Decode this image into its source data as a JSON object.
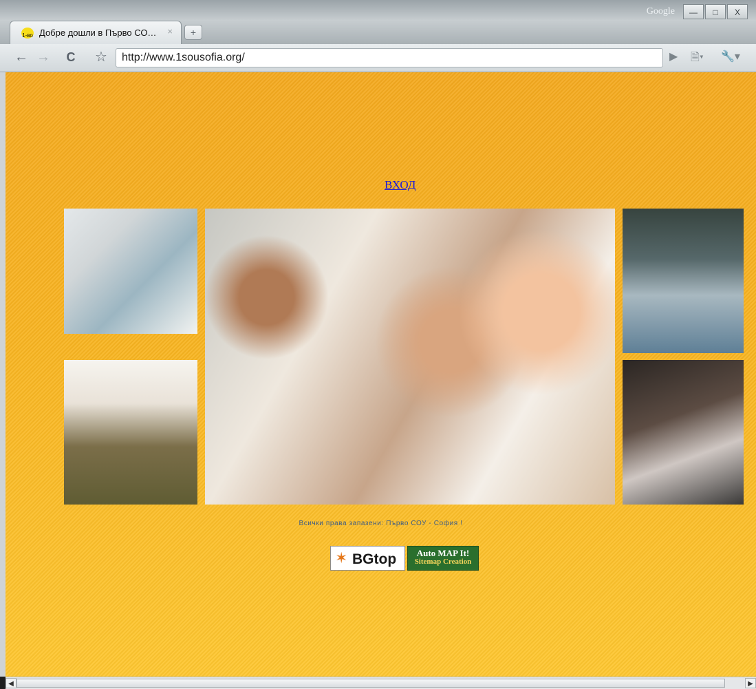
{
  "browser": {
    "tab_title": "Добре дошли в Първо СО…",
    "tab_favicon_text": "1-во",
    "new_tab_symbol": "+",
    "title_right_label": "Google",
    "window_buttons": [
      "—",
      "□",
      "X"
    ],
    "url": "http://www.1sousofia.org/",
    "back_icon": "←",
    "forward_icon": "→",
    "reload_icon": "C",
    "star_icon": "☆",
    "go_icon": "▶",
    "page_menu_icon": "🗎▾",
    "tools_menu_icon": "🔧▾"
  },
  "page": {
    "login_link": "ВХОД",
    "photos": [
      {
        "name": "boy-at-computer"
      },
      {
        "name": "two-boys-with-ball"
      },
      {
        "name": "group-of-smiling-teens"
      },
      {
        "name": "classroom-raised-hands"
      },
      {
        "name": "boy-playing-violin"
      }
    ],
    "copyright": "Всички права запазени:  Първо СОУ - София !",
    "badges": {
      "bgtop": "BGtop",
      "automap_title": "Auto MAP It!",
      "automap_sub": "Sitemap Creation"
    }
  },
  "colors": {
    "page_top": "#f4a91f",
    "page_bottom": "#fec730",
    "link": "#1b1bd6",
    "copyright": "#3f5d83"
  }
}
